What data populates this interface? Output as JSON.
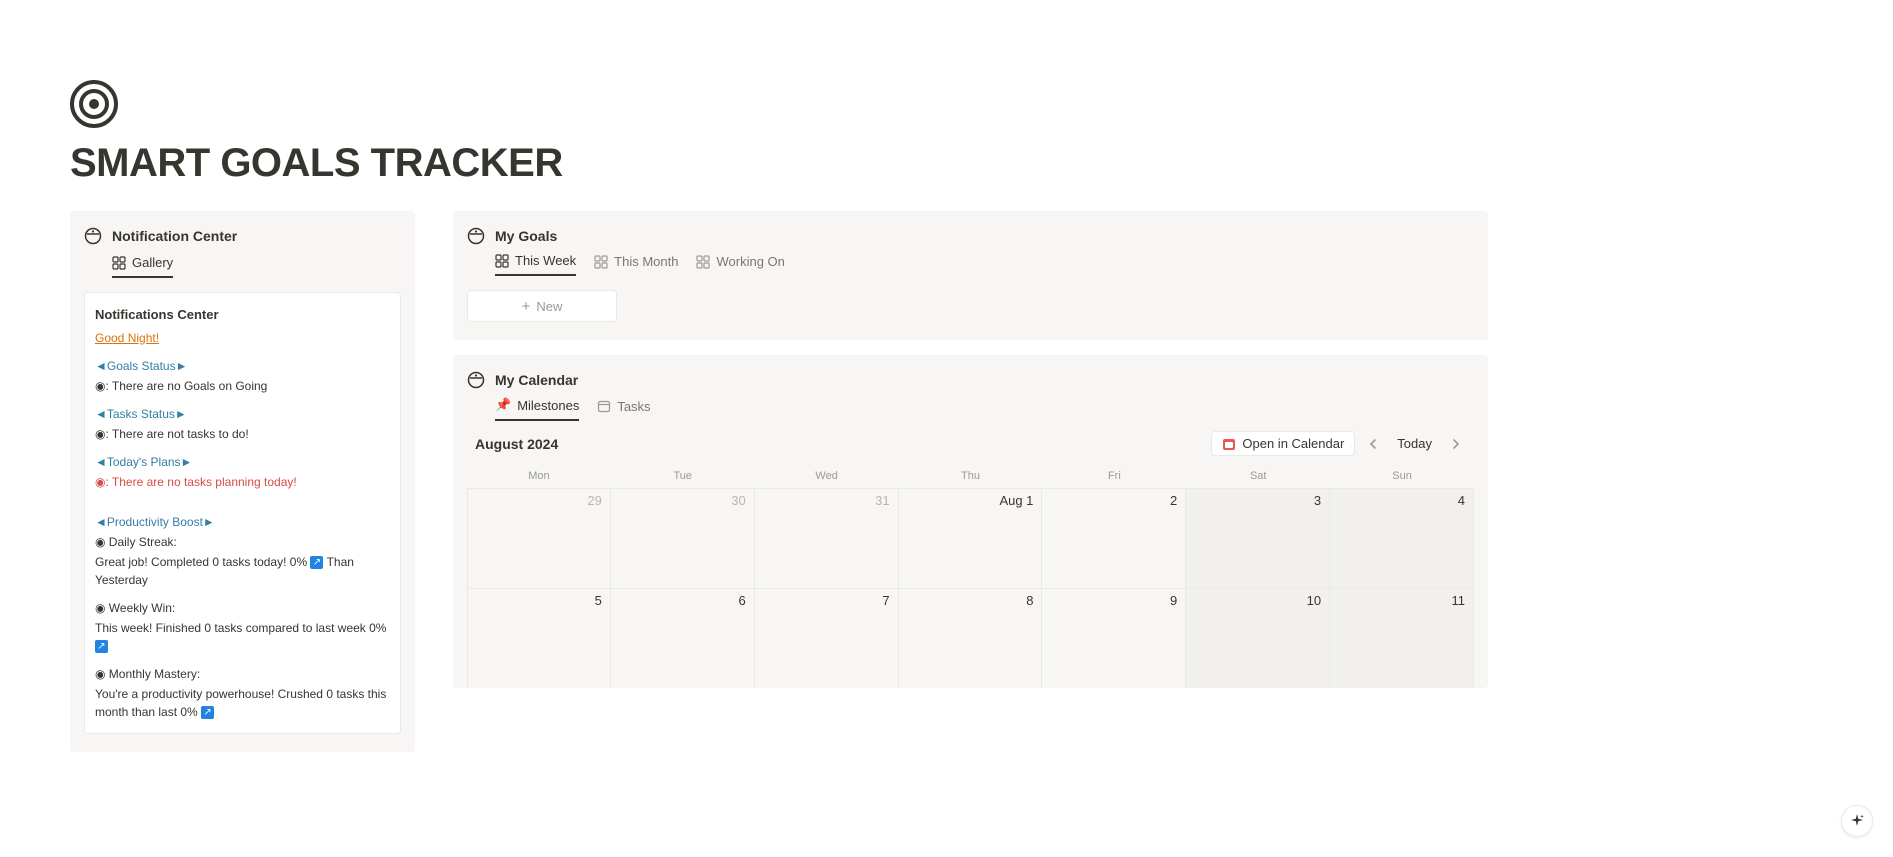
{
  "page": {
    "title": "SMART GOALS TRACKER"
  },
  "notification": {
    "header": "Notification Center",
    "tab_gallery": "Gallery",
    "card_title": "Notifications Center",
    "greeting": "Good Night!",
    "goals_status_label": "◄Goals Status►",
    "goals_status_text": "◉: There are no Goals on Going",
    "tasks_status_label": "◄Tasks Status►",
    "tasks_status_text": "◉: There are not tasks to do!",
    "todays_plans_label": "◄Today's Plans►",
    "todays_plans_text": "◉: There are no tasks planning today!",
    "productivity_label": "◄Productivity Boost►",
    "daily_streak_label": "◉ Daily Streak:",
    "daily_streak_text_a": "Great job! Completed 0 tasks today! 0% ",
    "daily_streak_text_b": " Than Yesterday",
    "weekly_win_label": "◉ Weekly Win:",
    "weekly_win_text": "This week! Finished 0 tasks compared to last week 0% ",
    "monthly_label": "◉ Monthly Mastery:",
    "monthly_text": "You're a productivity powerhouse!  Crushed 0 tasks this month than last 0% "
  },
  "goals": {
    "header": "My Goals",
    "tab_this_week": "This Week",
    "tab_this_month": "This Month",
    "tab_working_on": "Working On",
    "new_label": "New"
  },
  "calendar": {
    "header": "My Calendar",
    "tab_milestones": "Milestones",
    "tab_tasks": "Tasks",
    "month_label": "August 2024",
    "open_button": "Open in Calendar",
    "today_button": "Today",
    "weekdays": [
      "Mon",
      "Tue",
      "Wed",
      "Thu",
      "Fri",
      "Sat",
      "Sun"
    ],
    "rows": [
      [
        {
          "label": "29",
          "faded": true,
          "weekend": false
        },
        {
          "label": "30",
          "faded": true,
          "weekend": false
        },
        {
          "label": "31",
          "faded": true,
          "weekend": false
        },
        {
          "label": "Aug 1",
          "faded": false,
          "weekend": false
        },
        {
          "label": "2",
          "faded": false,
          "weekend": false
        },
        {
          "label": "3",
          "faded": false,
          "weekend": true
        },
        {
          "label": "4",
          "faded": false,
          "weekend": true
        }
      ],
      [
        {
          "label": "5",
          "faded": false,
          "weekend": false
        },
        {
          "label": "6",
          "faded": false,
          "weekend": false
        },
        {
          "label": "7",
          "faded": false,
          "weekend": false
        },
        {
          "label": "8",
          "faded": false,
          "weekend": false
        },
        {
          "label": "9",
          "faded": false,
          "weekend": false
        },
        {
          "label": "10",
          "faded": false,
          "weekend": true
        },
        {
          "label": "11",
          "faded": false,
          "weekend": true
        }
      ]
    ]
  }
}
